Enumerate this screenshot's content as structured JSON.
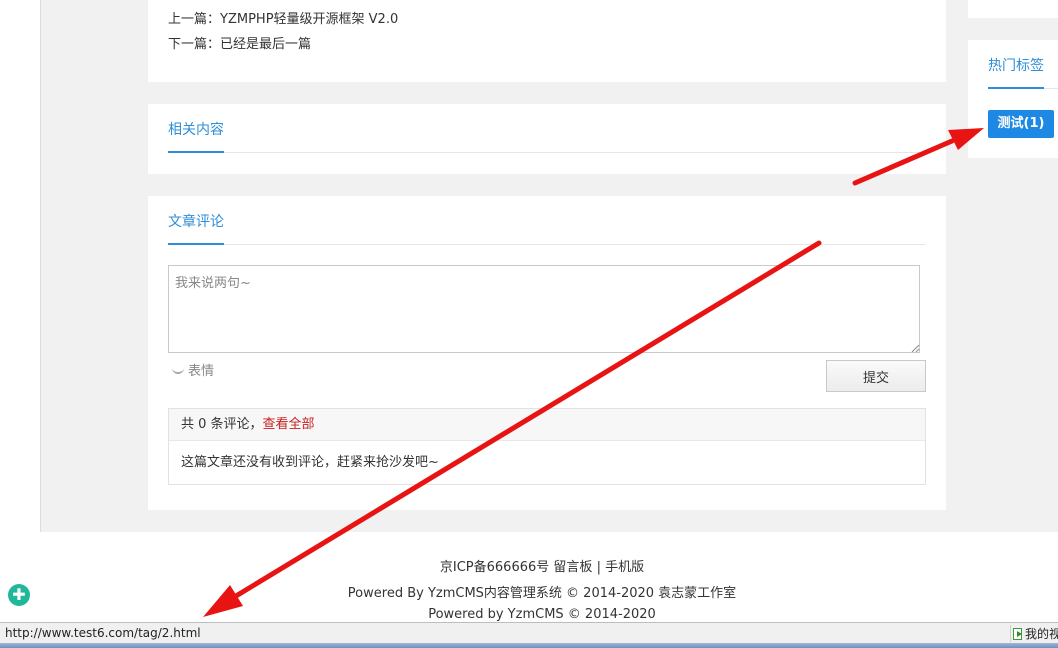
{
  "article_nav": {
    "prev_label": "上一篇：",
    "prev_title": "YZMPHP轻量级开源框架 V2.0",
    "next_label": "下一篇：",
    "next_title": "已经是最后一篇"
  },
  "related": {
    "tab_label": "相关内容"
  },
  "comments": {
    "tab_label": "文章评论",
    "placeholder": "我来说两句~",
    "emoji_label": "表情",
    "submit_label": "提交",
    "count_prefix": "共 0 条评论，",
    "view_all_label": "查看全部",
    "empty_text": "这篇文章还没有收到评论，赶紧来抢沙发吧~"
  },
  "sidebar": {
    "hot_tags_label": "热门标签",
    "tags": [
      {
        "label": "测试(1)"
      }
    ]
  },
  "footer": {
    "icp": "京ICP备666666号",
    "guestbook": "留言板",
    "separator": "|",
    "mobile": "手机版",
    "powered_line": "Powered By YzmCMS内容管理系统 © 2014-2020 袁志蒙工作室",
    "powered_line2": "Powered by YzmCMS © 2014-2020"
  },
  "status_bar": {
    "url": "http://www.test6.com/tag/2.html",
    "right_text": "我的视"
  },
  "colors": {
    "accent": "#2e8ed6",
    "tag_bg": "#1e88e5",
    "link_red": "#c91f1f",
    "annotation": "#e81414"
  },
  "icons": {
    "float": "plus-circle-icon",
    "emoji": "smile-icon",
    "status_right": "play-icon"
  }
}
